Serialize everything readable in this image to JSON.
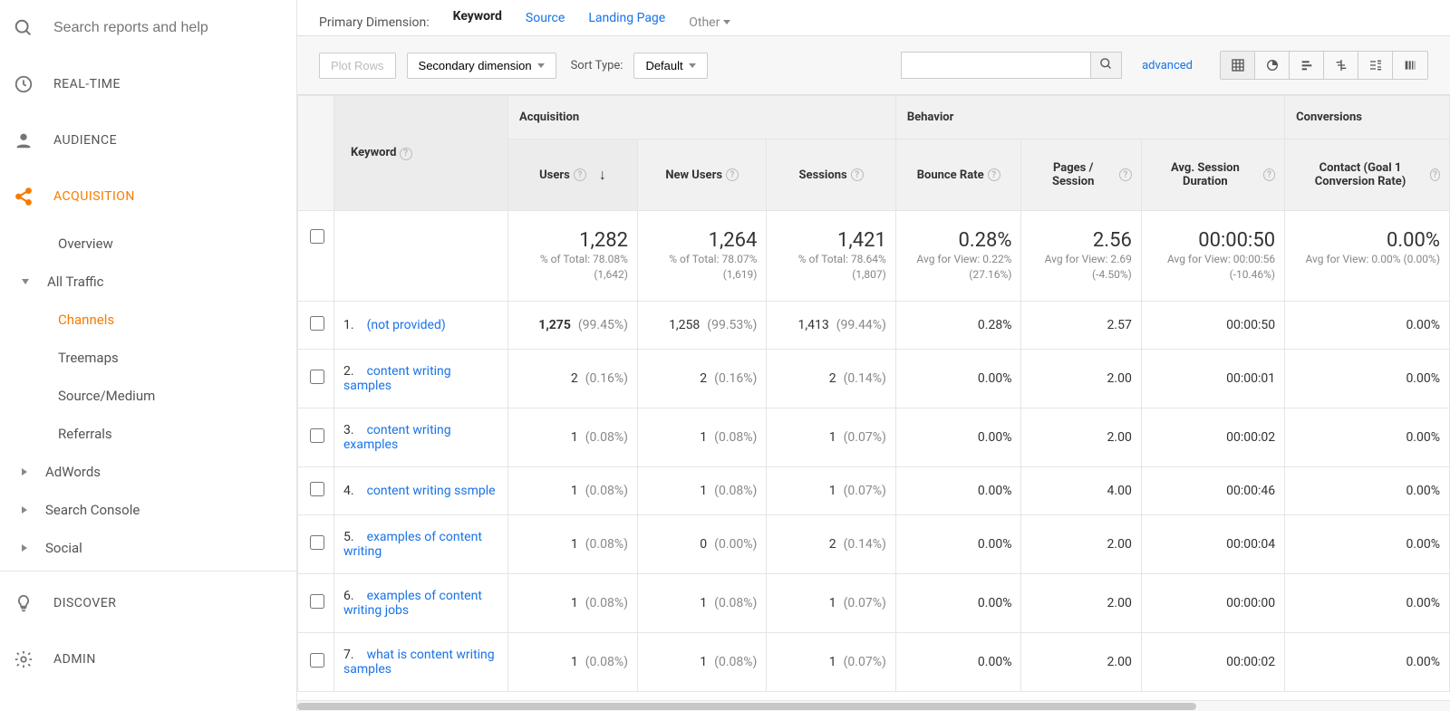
{
  "sidebar": {
    "search_placeholder": "Search reports and help",
    "items": {
      "realtime": "REAL-TIME",
      "audience": "AUDIENCE",
      "acquisition": "ACQUISITION",
      "discover": "DISCOVER",
      "admin": "ADMIN"
    },
    "acq_sub": {
      "overview": "Overview",
      "all_traffic": "All Traffic",
      "channels": "Channels",
      "treemaps": "Treemaps",
      "source_medium": "Source/Medium",
      "referrals": "Referrals",
      "adwords": "AdWords",
      "search_console": "Search Console",
      "social": "Social"
    }
  },
  "primary_dimension": {
    "label": "Primary Dimension:",
    "keyword": "Keyword",
    "source": "Source",
    "landing_page": "Landing Page",
    "other": "Other"
  },
  "toolbar": {
    "plot_rows": "Plot Rows",
    "secondary_dimension": "Secondary dimension",
    "sort_type": "Sort Type:",
    "default": "Default",
    "advanced": "advanced"
  },
  "groups": {
    "acquisition": "Acquisition",
    "behavior": "Behavior",
    "conversions": "Conversions"
  },
  "columns": {
    "keyword": "Keyword",
    "users": "Users",
    "new_users": "New Users",
    "sessions": "Sessions",
    "bounce_rate": "Bounce Rate",
    "pages_session": "Pages / Session",
    "avg_session_duration": "Avg. Session Duration",
    "contact_goal": "Contact (Goal 1 Conversion Rate)"
  },
  "totals": {
    "users": {
      "big": "1,282",
      "sub": "% of Total: 78.08% (1,642)"
    },
    "new_users": {
      "big": "1,264",
      "sub": "% of Total: 78.07% (1,619)"
    },
    "sessions": {
      "big": "1,421",
      "sub": "% of Total: 78.64% (1,807)"
    },
    "bounce_rate": {
      "big": "0.28%",
      "sub": "Avg for View: 0.22% (27.16%)"
    },
    "pages_session": {
      "big": "2.56",
      "sub": "Avg for View: 2.69 (-4.50%)"
    },
    "avg_session_duration": {
      "big": "00:00:50",
      "sub": "Avg for View: 00:00:56 (-10.46%)"
    },
    "contact_goal": {
      "big": "0.00%",
      "sub": "Avg for View: 0.00% (0.00%)"
    }
  },
  "rows": [
    {
      "idx": "1.",
      "keyword": "(not provided)",
      "users": "1,275",
      "users_pct": "(99.45%)",
      "new_users": "1,258",
      "new_users_pct": "(99.53%)",
      "sessions": "1,413",
      "sessions_pct": "(99.44%)",
      "bounce": "0.28%",
      "pages": "2.57",
      "duration": "00:00:50",
      "goal": "0.00%"
    },
    {
      "idx": "2.",
      "keyword": "content writing samples",
      "users": "2",
      "users_pct": "(0.16%)",
      "new_users": "2",
      "new_users_pct": "(0.16%)",
      "sessions": "2",
      "sessions_pct": "(0.14%)",
      "bounce": "0.00%",
      "pages": "2.00",
      "duration": "00:00:01",
      "goal": "0.00%"
    },
    {
      "idx": "3.",
      "keyword": "content writing examples",
      "users": "1",
      "users_pct": "(0.08%)",
      "new_users": "1",
      "new_users_pct": "(0.08%)",
      "sessions": "1",
      "sessions_pct": "(0.07%)",
      "bounce": "0.00%",
      "pages": "2.00",
      "duration": "00:00:02",
      "goal": "0.00%"
    },
    {
      "idx": "4.",
      "keyword": "content writing ssmple",
      "users": "1",
      "users_pct": "(0.08%)",
      "new_users": "1",
      "new_users_pct": "(0.08%)",
      "sessions": "1",
      "sessions_pct": "(0.07%)",
      "bounce": "0.00%",
      "pages": "4.00",
      "duration": "00:00:46",
      "goal": "0.00%"
    },
    {
      "idx": "5.",
      "keyword": "examples of content writing",
      "users": "1",
      "users_pct": "(0.08%)",
      "new_users": "0",
      "new_users_pct": "(0.00%)",
      "sessions": "2",
      "sessions_pct": "(0.14%)",
      "bounce": "0.00%",
      "pages": "2.00",
      "duration": "00:00:04",
      "goal": "0.00%"
    },
    {
      "idx": "6.",
      "keyword": "examples of content writing jobs",
      "users": "1",
      "users_pct": "(0.08%)",
      "new_users": "1",
      "new_users_pct": "(0.08%)",
      "sessions": "1",
      "sessions_pct": "(0.07%)",
      "bounce": "0.00%",
      "pages": "2.00",
      "duration": "00:00:00",
      "goal": "0.00%"
    },
    {
      "idx": "7.",
      "keyword": "what is content writing samples",
      "users": "1",
      "users_pct": "(0.08%)",
      "new_users": "1",
      "new_users_pct": "(0.08%)",
      "sessions": "1",
      "sessions_pct": "(0.07%)",
      "bounce": "0.00%",
      "pages": "2.00",
      "duration": "00:00:02",
      "goal": "0.00%"
    }
  ]
}
